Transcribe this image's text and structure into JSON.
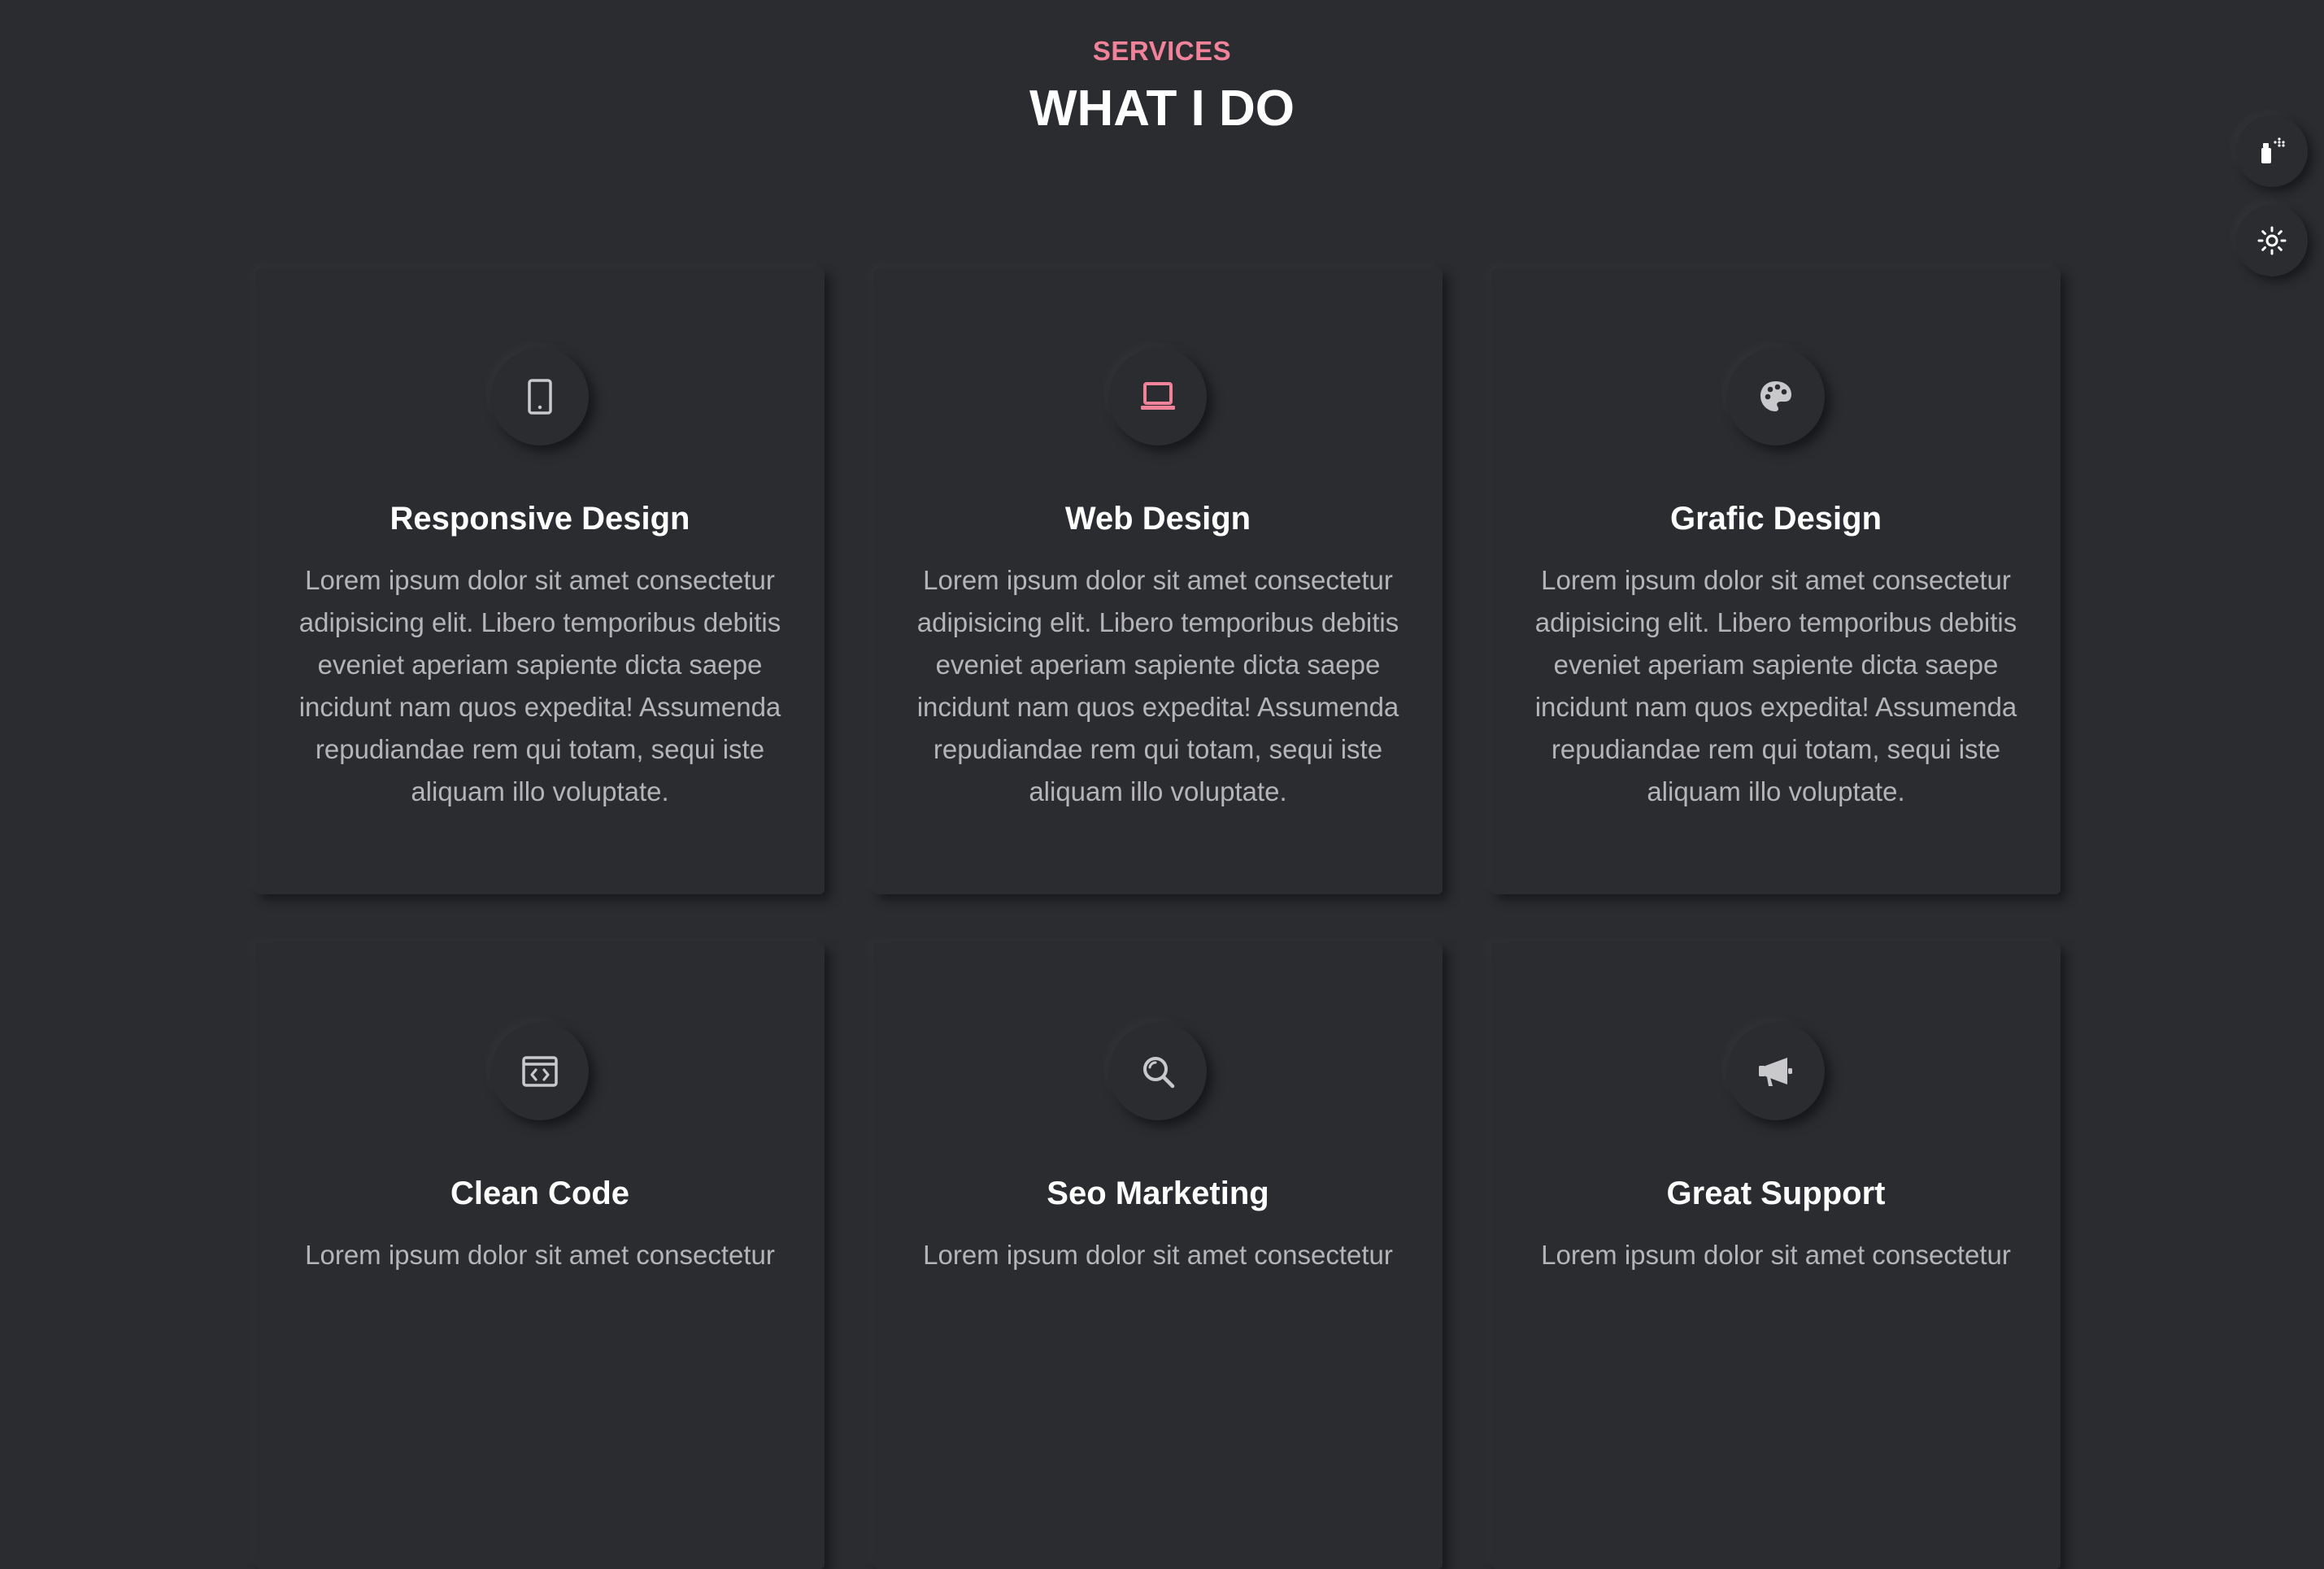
{
  "header": {
    "subtitle": "SERVICES",
    "title": "WHAT I DO"
  },
  "colors": {
    "background": "#2b2c30",
    "accent": "#f0829a",
    "heading": "#ffffff",
    "body_text": "#b5b5b9",
    "icon": "#c9c9cc"
  },
  "side_controls": {
    "colors_button_icon": "spray-paint-icon",
    "theme_button_icon": "sun-icon"
  },
  "services": [
    {
      "icon": "tablet-icon",
      "title": "Responsive Design",
      "text": "Lorem ipsum dolor sit amet consectetur adipisicing elit. Libero temporibus debitis eveniet aperiam sapiente dicta saepe incidunt nam quos expedita! Assumenda repudiandae rem qui totam, sequi iste aliquam illo voluptate."
    },
    {
      "icon": "laptop-icon",
      "title": "Web Design",
      "text": "Lorem ipsum dolor sit amet consectetur adipisicing elit. Libero temporibus debitis eveniet aperiam sapiente dicta saepe incidunt nam quos expedita! Assumenda repudiandae rem qui totam, sequi iste aliquam illo voluptate."
    },
    {
      "icon": "palette-icon",
      "title": "Grafic Design",
      "text": "Lorem ipsum dolor sit amet consectetur adipisicing elit. Libero temporibus debitis eveniet aperiam sapiente dicta saepe incidunt nam quos expedita! Assumenda repudiandae rem qui totam, sequi iste aliquam illo voluptate."
    },
    {
      "icon": "code-window-icon",
      "title": "Clean Code",
      "text": "Lorem ipsum dolor sit amet consectetur"
    },
    {
      "icon": "search-icon",
      "title": "Seo Marketing",
      "text": "Lorem ipsum dolor sit amet consectetur"
    },
    {
      "icon": "megaphone-icon",
      "title": "Great Support",
      "text": "Lorem ipsum dolor sit amet consectetur"
    }
  ]
}
